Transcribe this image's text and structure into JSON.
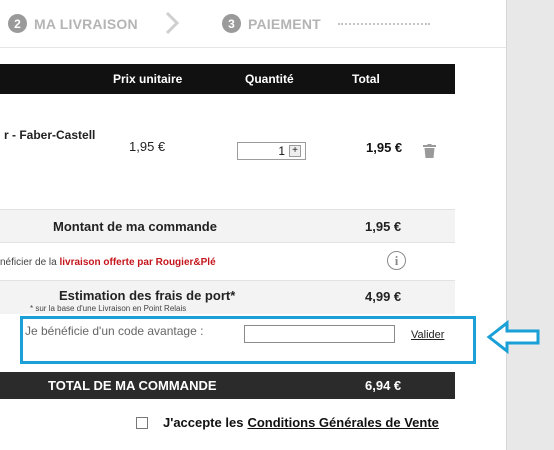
{
  "steps": [
    {
      "num": "2",
      "label": "MA LIVRAISON"
    },
    {
      "num": "3",
      "label": "PAIEMENT"
    }
  ],
  "table_header": {
    "unit_price": "Prix unitaire",
    "quantity": "Quantité",
    "total": "Total"
  },
  "product": {
    "name_visible": "r - Faber-Castell",
    "unit_price": "1,95 €",
    "quantity": "1",
    "plus": "+",
    "total": "1,95 €"
  },
  "summary": {
    "montant_label": "Montant de ma commande",
    "montant_value": "1,95 €",
    "livraison_prefix": "néficier de la ",
    "livraison_link": "livraison offerte par Rougier&Plé",
    "info_glyph": "i",
    "estimation_label": "Estimation des frais de port*",
    "estimation_note": "* sur la base d'une Livraison en Point Relais",
    "estimation_value": "4,99 €"
  },
  "promo": {
    "label": "Je bénéficie d'un code avantage :",
    "input_value": "",
    "submit": "Valider"
  },
  "total": {
    "label": "TOTAL DE MA COMMANDE",
    "value": "6,94 €"
  },
  "terms": {
    "prefix": "J'accepte les",
    "link": "Conditions Générales de Vente"
  },
  "colors": {
    "highlight": "#1a9fd6",
    "promo_red": "#c4161c",
    "header_bg": "#111111",
    "total_bg": "#2b2b2b"
  }
}
